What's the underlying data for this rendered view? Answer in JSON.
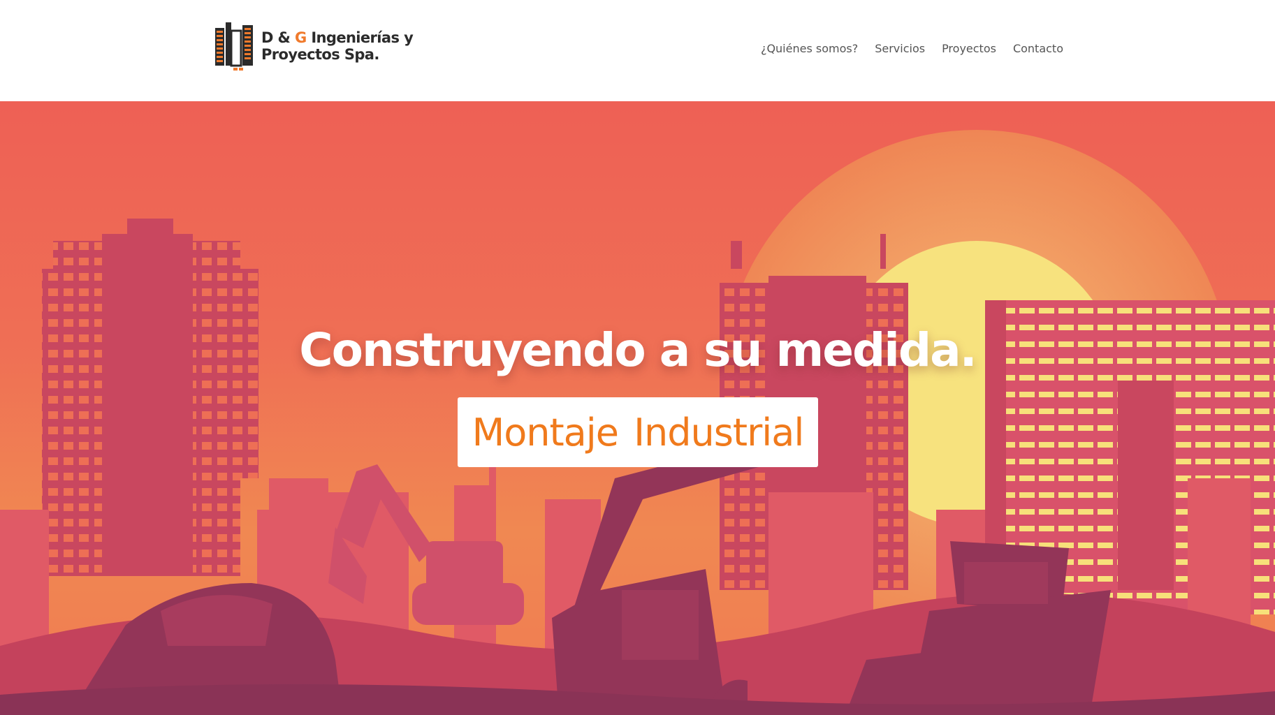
{
  "header": {
    "logo": {
      "line1_prefix": "D & ",
      "line1_accent": "G",
      "line1_suffix": " Ingenierías y",
      "line2": "Proyectos Spa."
    },
    "nav": [
      {
        "label": "¿Quiénes somos?"
      },
      {
        "label": "Servicios"
      },
      {
        "label": "Proyectos"
      },
      {
        "label": "Contacto"
      }
    ]
  },
  "hero": {
    "title": "Construyendo a su medida.",
    "badge": "Montaje Industrial"
  },
  "colors": {
    "accent": "#f07a1c",
    "hero_bg": "#ee6055",
    "nav_text": "#555555"
  }
}
